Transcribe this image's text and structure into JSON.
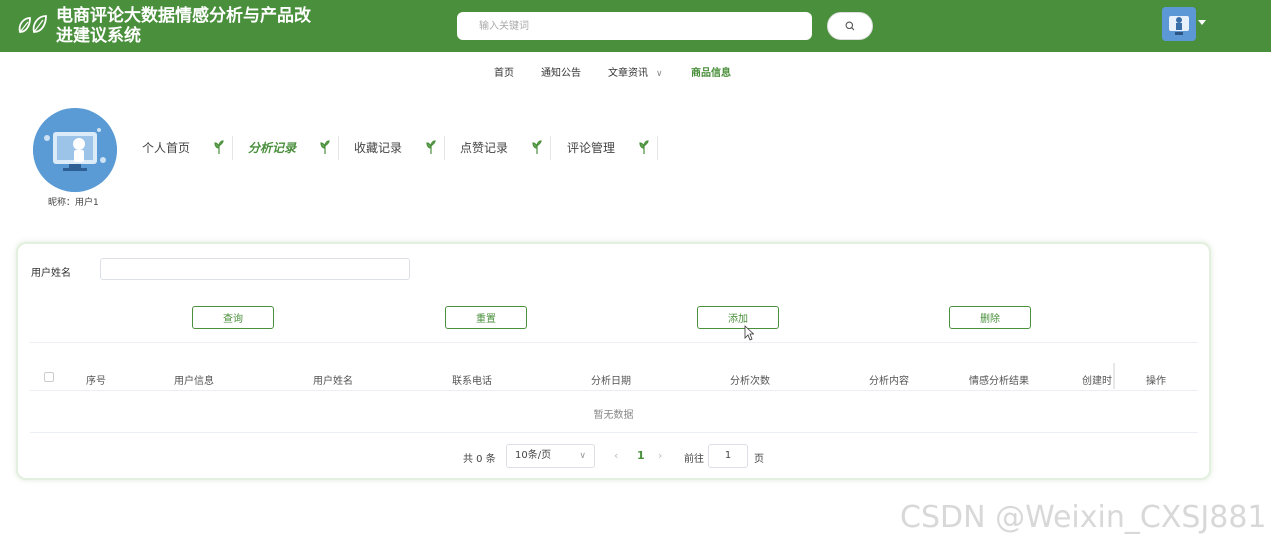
{
  "header": {
    "app_title": "电商评论大数据情感分析与产品改进建议系统",
    "search_placeholder": "输入关键词",
    "brand_color": "#4a8f3c"
  },
  "nav": {
    "items": [
      {
        "label": "首页",
        "active": false
      },
      {
        "label": "通知公告",
        "active": false
      },
      {
        "label": "文章资讯",
        "active": false,
        "has_dropdown": true
      },
      {
        "label": "商品信息",
        "active": true
      }
    ]
  },
  "profile": {
    "nickname": "昵称：用户1",
    "tabs": [
      {
        "label": "个人首页",
        "active": false
      },
      {
        "label": "分析记录",
        "active": true
      },
      {
        "label": "收藏记录",
        "active": false
      },
      {
        "label": "点赞记录",
        "active": false
      },
      {
        "label": "评论管理",
        "active": false
      }
    ]
  },
  "search_form": {
    "field_label": "用户姓名",
    "field_value": ""
  },
  "buttons": {
    "query": "查询",
    "reset": "重置",
    "add": "添加",
    "delete": "删除"
  },
  "table": {
    "columns": [
      "序号",
      "用户信息",
      "用户姓名",
      "联系电话",
      "分析日期",
      "分析次数",
      "分析内容",
      "情感分析结果",
      "创建时",
      "操作"
    ],
    "rows": [],
    "empty_text": "暂无数据"
  },
  "pagination": {
    "total_text": "共 0 条",
    "page_size": "10条/页",
    "current_page": "1",
    "goto_label": "前往",
    "goto_value": "1",
    "page_suffix": "页"
  },
  "watermark": "CSDN @Weixin_CXSJ881"
}
